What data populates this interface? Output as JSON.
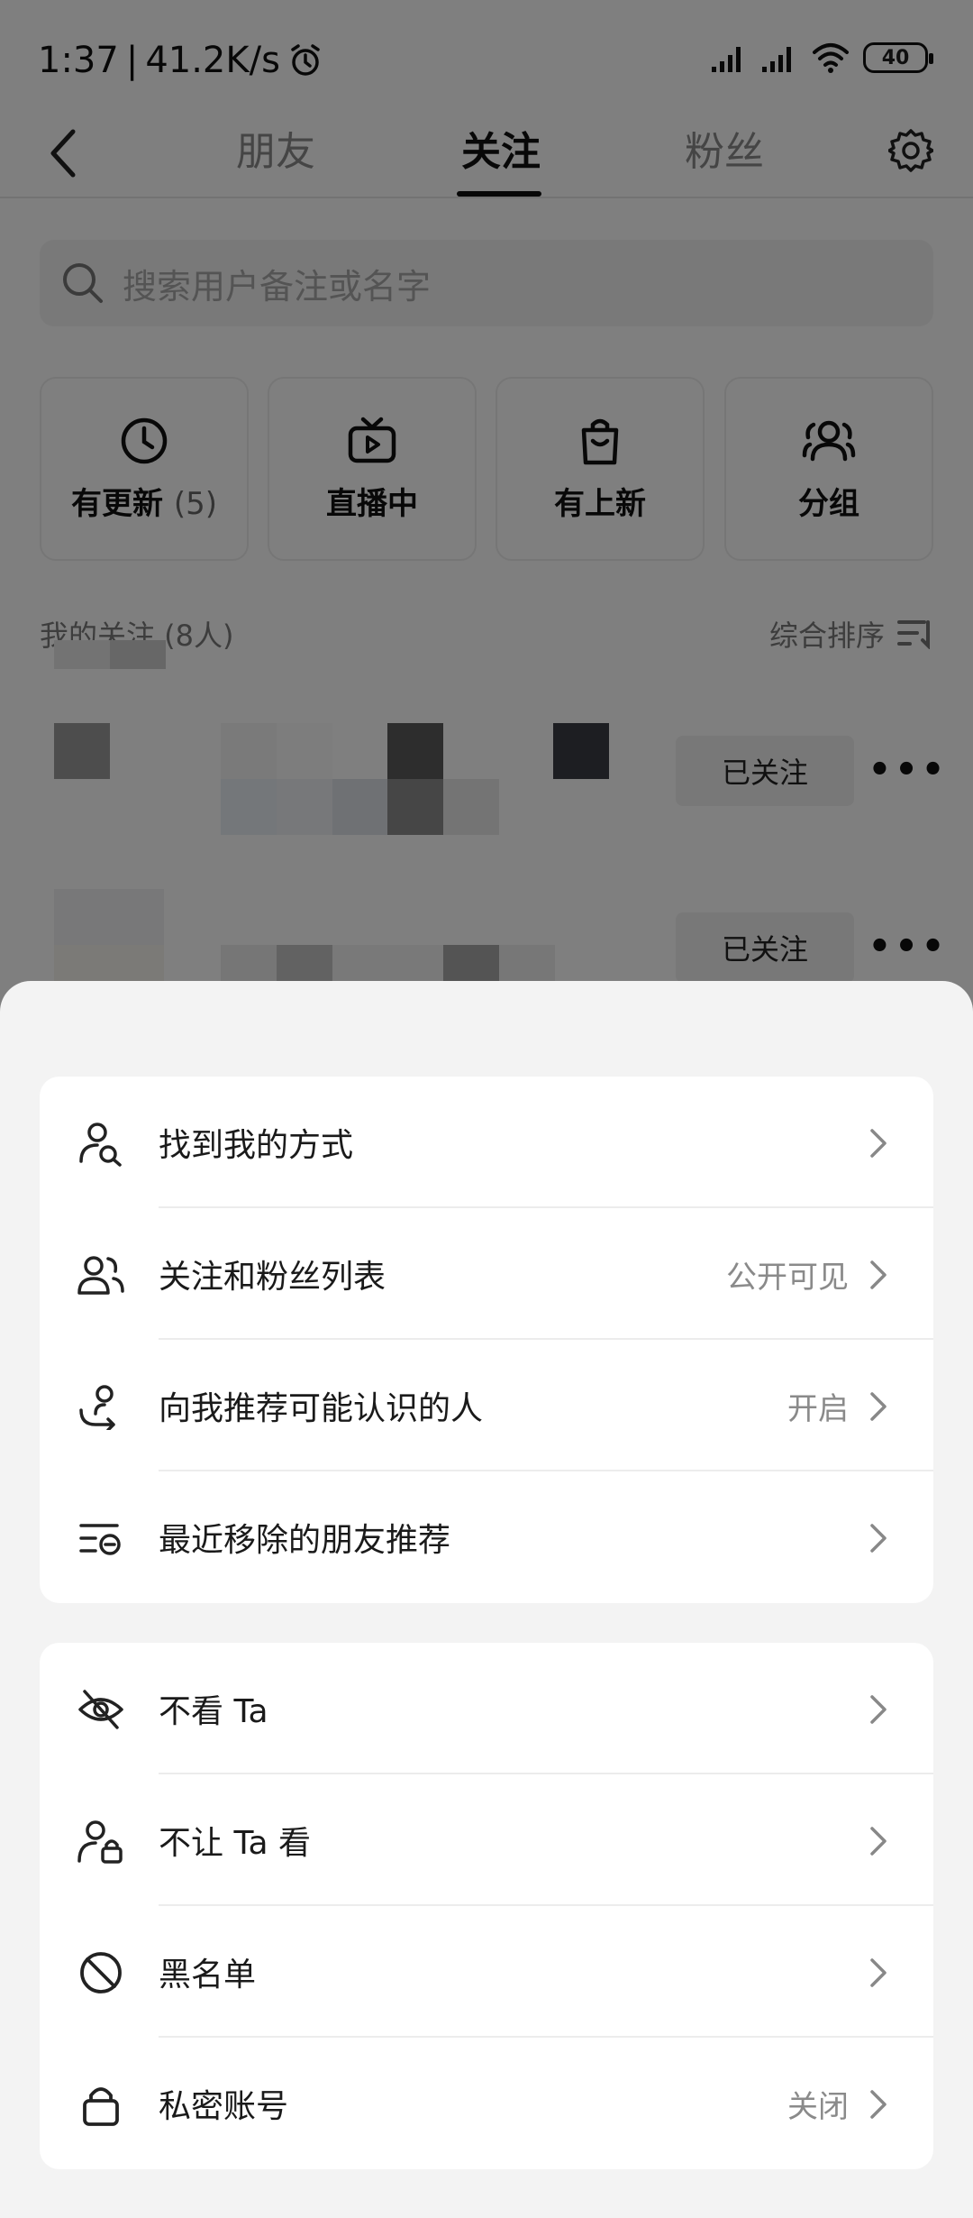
{
  "status_bar": {
    "time": "1:37",
    "speed": "41.2K/s",
    "battery": "40",
    "icons": [
      "alarm-icon",
      "signal-icon",
      "signal-icon",
      "wifi-icon",
      "battery-icon"
    ]
  },
  "nav": {
    "tabs": [
      {
        "label": "朋友"
      },
      {
        "label": "关注"
      },
      {
        "label": "粉丝"
      }
    ],
    "active_tab": "关注"
  },
  "search": {
    "placeholder": "搜索用户备注或名字"
  },
  "quick_filters": [
    {
      "label": "有更新",
      "count": "(5)",
      "icon": "clock-icon"
    },
    {
      "label": "直播中",
      "icon": "live-tv-icon"
    },
    {
      "label": "有上新",
      "icon": "shopping-bag-icon"
    },
    {
      "label": "分组",
      "icon": "group-icon"
    }
  ],
  "following": {
    "header": "我的关注 (8人)",
    "sort_label": "综合排序",
    "rows": [
      {
        "button": "已关注"
      },
      {
        "button": "已关注"
      }
    ]
  },
  "sheet": {
    "group1": [
      {
        "label": "找到我的方式",
        "value": "",
        "icon": "person-search-icon"
      },
      {
        "label": "关注和粉丝列表",
        "value": "公开可见",
        "icon": "people-icon"
      },
      {
        "label": "向我推荐可能认识的人",
        "value": "开启",
        "icon": "recommend-person-icon"
      },
      {
        "label": "最近移除的朋友推荐",
        "value": "",
        "icon": "list-removed-icon"
      }
    ],
    "group2": [
      {
        "label": "不看 Ta",
        "value": "",
        "icon": "eye-off-icon"
      },
      {
        "label": "不让 Ta 看",
        "value": "",
        "icon": "person-lock-icon"
      },
      {
        "label": "黑名单",
        "value": "",
        "icon": "block-icon"
      },
      {
        "label": "私密账号",
        "value": "关闭",
        "icon": "lock-icon"
      }
    ]
  },
  "colors": {
    "overlay": "#808080",
    "sheet_bg": "#f3f3f3",
    "card_bg": "#ffffff",
    "text_primary": "#1a1a1a",
    "text_secondary": "#8a8a8a"
  }
}
